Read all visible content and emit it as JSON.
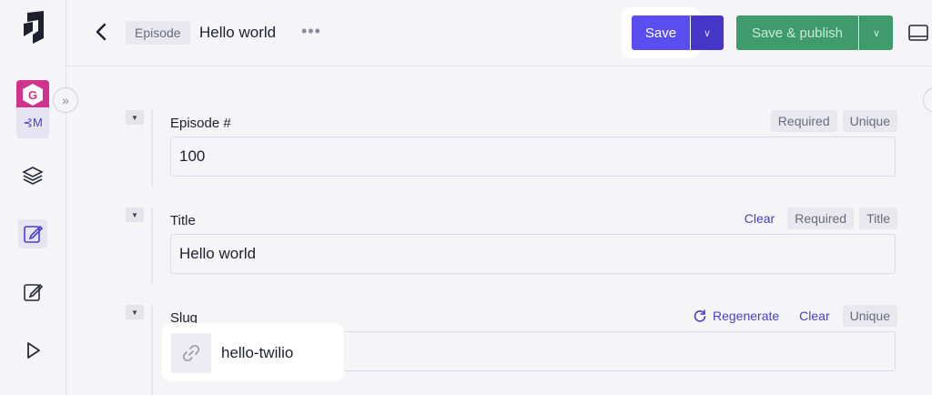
{
  "header": {
    "model_badge": "Episode",
    "entry_title": "Hello world",
    "save_label": "Save",
    "publish_label": "Save & publish"
  },
  "sidebar": {
    "project_switch_label": "⊰M"
  },
  "fields": [
    {
      "label": "Episode #",
      "value": "100",
      "tags": [
        "Required",
        "Unique"
      ]
    },
    {
      "label": "Title",
      "value": "Hello world",
      "action": "Clear",
      "tags": [
        "Required",
        "Title"
      ]
    },
    {
      "label": "Slug",
      "value": "hello-twilio",
      "regenerate": "Regenerate",
      "action": "Clear",
      "tags": [
        "Unique"
      ]
    }
  ],
  "colors": {
    "accent": "#5b4ef0",
    "accent_dark": "#4536c7",
    "publish": "#3f9b6c",
    "avatar": "#d0338b"
  }
}
